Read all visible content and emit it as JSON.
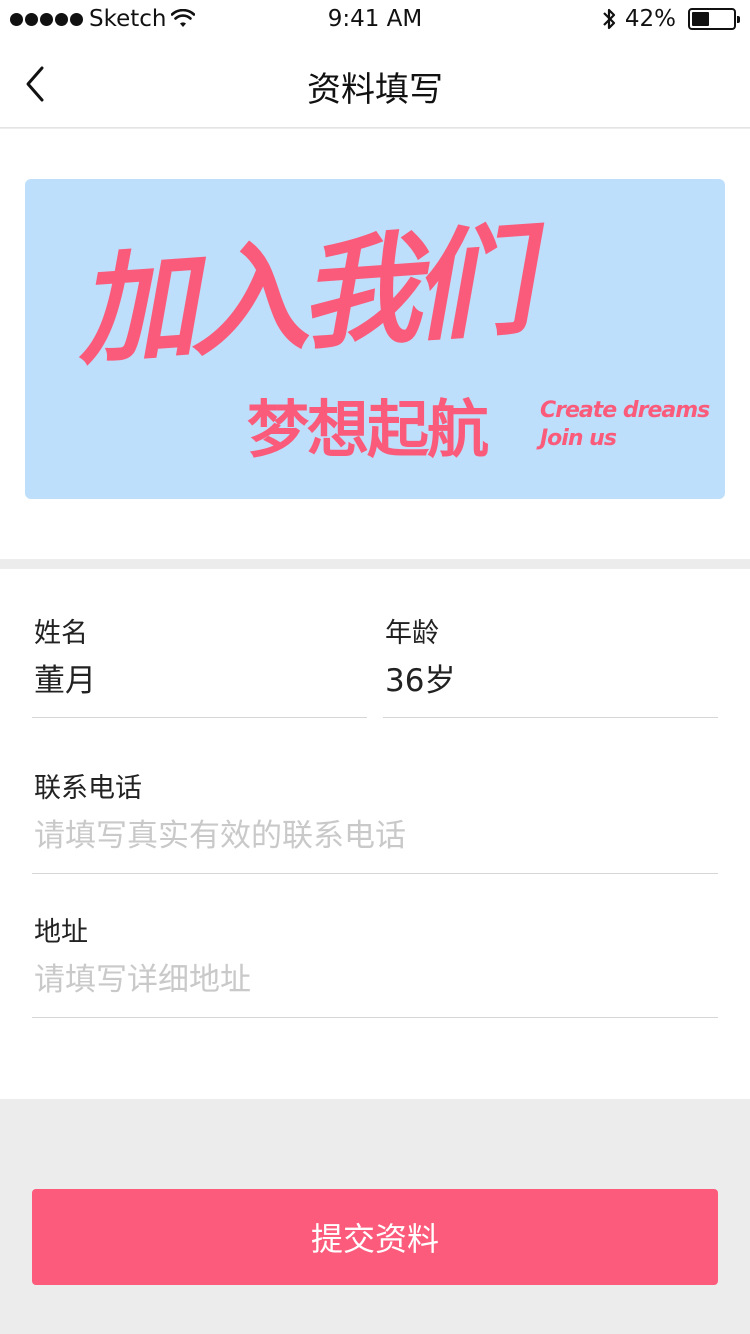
{
  "status_bar": {
    "carrier": "Sketch",
    "time": "9:41 AM",
    "battery_percent": "42%",
    "battery_level": 0.42,
    "icons": [
      "signal-dots-icon",
      "wifi-icon",
      "bluetooth-icon",
      "battery-icon"
    ]
  },
  "nav": {
    "title": "资料填写",
    "back_icon": "chevron-left-icon"
  },
  "banner": {
    "title": "加入我们",
    "subtitle": "梦想起航",
    "english_line1": "Create dreams",
    "english_line2": "Join us",
    "background_color": "#bddffb",
    "text_color": "#fb5b7b"
  },
  "form": {
    "name": {
      "label": "姓名",
      "value": "董月"
    },
    "age": {
      "label": "年龄",
      "value": "36岁"
    },
    "phone": {
      "label": "联系电话",
      "placeholder": "请填写真实有效的联系电话"
    },
    "address": {
      "label": "地址",
      "placeholder": "请填写详细地址"
    }
  },
  "submit": {
    "label": "提交资料",
    "color": "#fc5b7b"
  }
}
